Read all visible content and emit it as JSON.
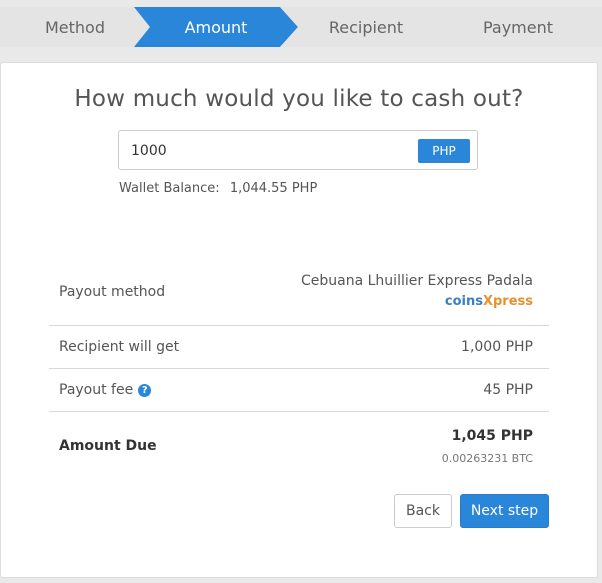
{
  "stepper": {
    "steps": [
      {
        "label": "Method"
      },
      {
        "label": "Amount"
      },
      {
        "label": "Recipient"
      },
      {
        "label": "Payment"
      }
    ],
    "active_color": "#2a86d8",
    "inactive_color": "#e4e4e4"
  },
  "main": {
    "title": "How much would you like to cash out?",
    "amount": {
      "value": "1000",
      "currency": "PHP"
    },
    "balance": {
      "label": "Wallet Balance:",
      "value": "1,044.55 PHP"
    }
  },
  "summary": {
    "payout_method": {
      "label": "Payout method",
      "provider": "Cebuana Lhuillier Express Padala",
      "brand_part1": "coins",
      "brand_part2": "Xpress"
    },
    "recipient_gets": {
      "label": "Recipient will get",
      "value": "1,000 PHP"
    },
    "payout_fee": {
      "label": "Payout fee",
      "help_icon": "question-circle-icon",
      "value": "45 PHP"
    },
    "amount_due": {
      "label": "Amount Due",
      "value": "1,045 PHP",
      "btc": "0.00263231 BTC"
    }
  },
  "actions": {
    "back_label": "Back",
    "next_label": "Next step"
  }
}
